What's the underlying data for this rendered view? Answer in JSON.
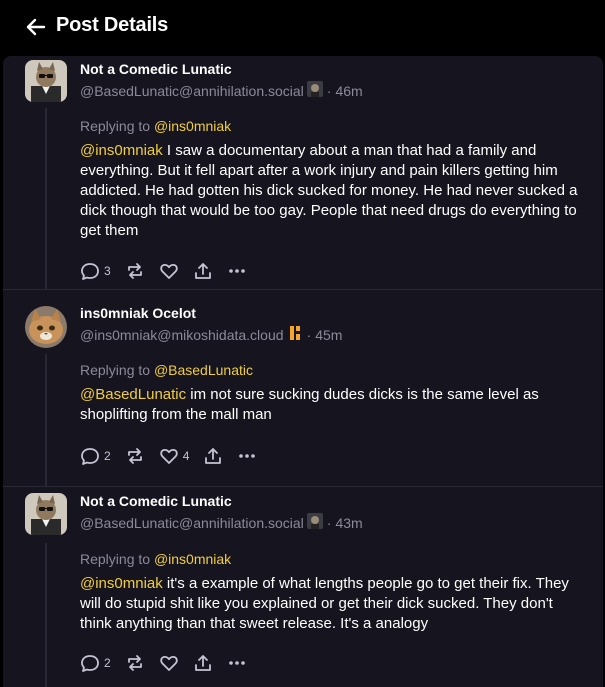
{
  "header": {
    "title": "Post Details"
  },
  "posts": [
    {
      "author_name": "Not a Comedic Lunatic",
      "handle": "@BasedLunatic@annihilation.social",
      "time": "46m",
      "replying_prefix": "Replying to ",
      "replying_to": "@ins0mniak",
      "mention": "@ins0mniak",
      "text": " I saw a documentary about a man that had a family and everything. But it fell apart after a work injury and pain killers getting him addicted. He had gotten his dick sucked for money. He had never sucked a dick though that would be too gay. People that need drugs do everything to get them",
      "replies": "3",
      "reposts": "",
      "likes": ""
    },
    {
      "author_name": "ins0mniak Ocelot",
      "handle": "@ins0mniak@mikoshidata.cloud",
      "time": "45m",
      "replying_prefix": "Replying to ",
      "replying_to": "@BasedLunatic",
      "mention": "@BasedLunatic",
      "text": " im not sure sucking dudes dicks is the same level as shoplifting from the mall man",
      "replies": "2",
      "reposts": "",
      "likes": "4"
    },
    {
      "author_name": "Not a Comedic Lunatic",
      "handle": "@BasedLunatic@annihilation.social",
      "time": "43m",
      "replying_prefix": "Replying to ",
      "replying_to": "@ins0mniak",
      "mention": "@ins0mniak",
      "text": " it's a example of what lengths people go to get their fix. They will do stupid shit like you explained or get their dick sucked. They don't think anything than that sweet release. It's a analogy",
      "replies": "2",
      "reposts": "",
      "likes": ""
    }
  ],
  "separator": "·",
  "colors": {
    "background": "#000000",
    "panel": "#16141f",
    "mention": "#f1ce3c",
    "muted": "#8c8a99",
    "divider": "#2a2735"
  }
}
